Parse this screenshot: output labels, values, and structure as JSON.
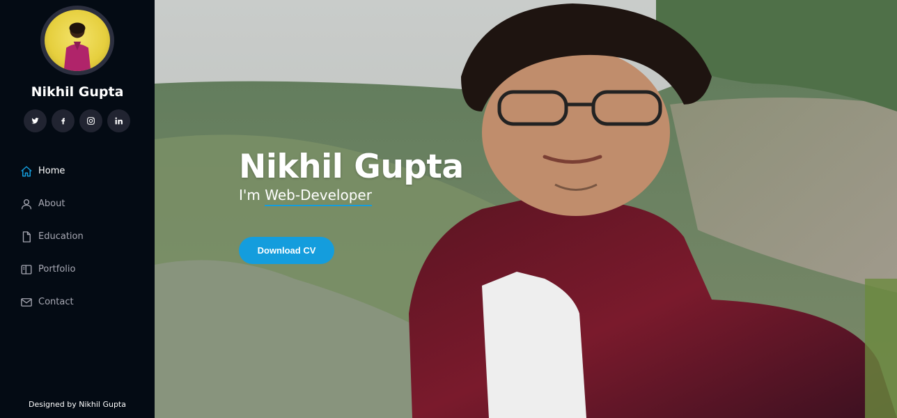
{
  "profile": {
    "name": "Nikhil Gupta"
  },
  "socials": [
    {
      "icon": "twitter-icon",
      "glyph": "🐦"
    },
    {
      "icon": "facebook-icon",
      "glyph": "f"
    },
    {
      "icon": "instagram-icon",
      "glyph": "◎"
    },
    {
      "icon": "linkedin-icon",
      "glyph": "in"
    }
  ],
  "nav": {
    "items": [
      {
        "label": "Home",
        "icon": "home-icon",
        "active": true
      },
      {
        "label": "About",
        "icon": "user-icon",
        "active": false
      },
      {
        "label": "Education",
        "icon": "file-icon",
        "active": false
      },
      {
        "label": "Portfolio",
        "icon": "book-icon",
        "active": false
      },
      {
        "label": "Contact",
        "icon": "envelope-icon",
        "active": false
      }
    ]
  },
  "footer": {
    "text": "Designed by Nikhil Gupta"
  },
  "hero": {
    "title": "Nikhil Gupta",
    "prefix": "I'm ",
    "typed": "Web-Developer",
    "button_label": "Download CV"
  },
  "colors": {
    "sidebar_bg": "#040b14",
    "accent": "#149ddd",
    "social_bg": "#212431",
    "nav_inactive": "#a8a9b4"
  }
}
